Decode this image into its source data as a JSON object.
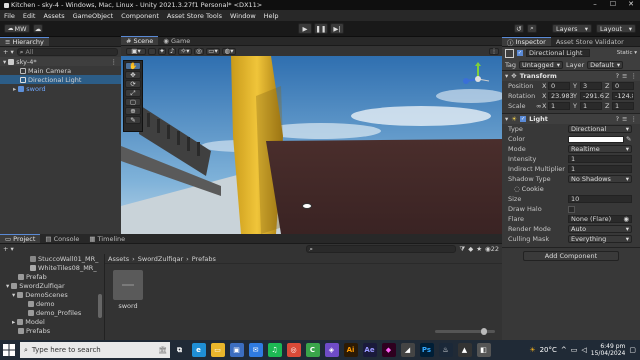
{
  "window": {
    "title": "Kitchen - sky-4 - Windows, Mac, Linux - Unity 2021.3.27f1 Personal* <DX11>"
  },
  "menu": [
    "File",
    "Edit",
    "Assets",
    "GameObject",
    "Component",
    "Asset Store Tools",
    "Window",
    "Help"
  ],
  "toolbar": {
    "account": "MW",
    "layers": "Layers",
    "layout": "Layout"
  },
  "hierarchy": {
    "tab": "Hierarchy",
    "search_placeholder": "All",
    "scene": "sky-4*",
    "items": [
      "Main Camera",
      "Directional Light",
      "sword"
    ]
  },
  "scene_view": {
    "tabs": [
      "Scene",
      "Game"
    ]
  },
  "inspector": {
    "tabs": [
      "Inspector",
      "Asset Store Validator"
    ],
    "static": "Static",
    "object_name": "Directional Light",
    "tag_label": "Tag",
    "tag": "Untagged",
    "layer_label": "Layer",
    "layer": "Default",
    "transform": {
      "title": "Transform",
      "rows": [
        {
          "label": "Position",
          "x": "0",
          "y": "3",
          "z": "0"
        },
        {
          "label": "Rotation",
          "x": "23.983",
          "y": "-291.6",
          "z": "-124.8"
        },
        {
          "label": "Scale",
          "x": "1",
          "y": "1",
          "z": "1"
        }
      ]
    },
    "light": {
      "title": "Light",
      "type_label": "Type",
      "type": "Directional",
      "color_label": "Color",
      "color": "#ffffff",
      "mode_label": "Mode",
      "mode": "Realtime",
      "intensity_label": "Intensity",
      "intensity": "1",
      "indirect_label": "Indirect Multiplier",
      "indirect": "1",
      "shadow_label": "Shadow Type",
      "shadow": "No Shadows",
      "cookie_label": "Cookie",
      "size_label": "Size",
      "size": "10",
      "halo_label": "Draw Halo",
      "flare_label": "Flare",
      "flare": "None (Flare)",
      "render_label": "Render Mode",
      "render": "Auto",
      "culling_label": "Culling Mask",
      "culling": "Everything"
    },
    "add_component": "Add Component"
  },
  "project": {
    "tabs": [
      "Project",
      "Console",
      "Timeline"
    ],
    "tree": [
      "StuccoWall01_MR_",
      "WhiteTiles08_MR_",
      "Prefab",
      "SwordZulfiqar",
      "DemoScenes",
      "demo",
      "demo_Profiles",
      "Model",
      "Prefabs"
    ],
    "breadcrumb": [
      "Assets",
      "SwordZulfiqar",
      "Prefabs"
    ],
    "asset": "sword"
  },
  "taskbar": {
    "search_placeholder": "Type here to search",
    "weather": "20°C",
    "time": "6:49 pm",
    "date": "15/04/2024"
  },
  "colors": {
    "selection": "#2c5d87",
    "accent": "#5a8ad6",
    "panel": "#383838"
  }
}
